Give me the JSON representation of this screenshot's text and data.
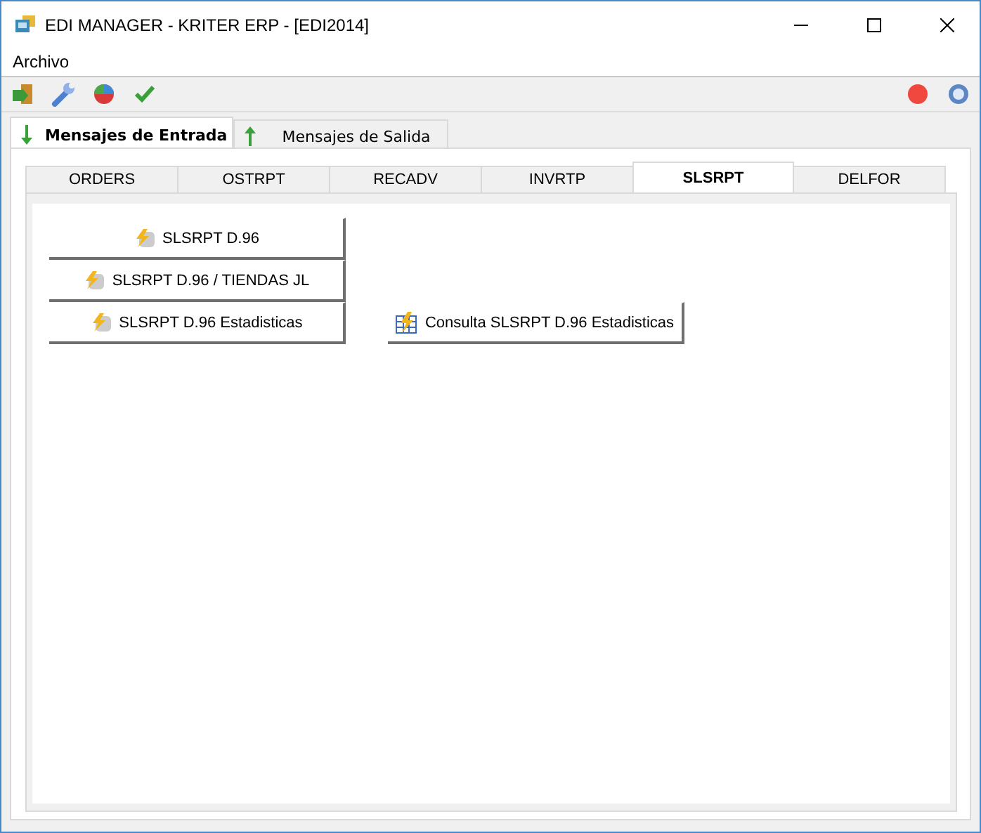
{
  "window": {
    "title": "EDI MANAGER - KRITER ERP - [EDI2014]"
  },
  "menu": [
    "Archivo"
  ],
  "toolbar": [
    {
      "kind": "exit"
    },
    {
      "kind": "wrench"
    },
    {
      "kind": "chart"
    },
    {
      "kind": "check"
    }
  ],
  "toolbar_right": [
    {
      "kind": "stop"
    },
    {
      "kind": "help"
    }
  ],
  "outer_tabs": [
    {
      "label": "Mensajes de Entrada",
      "kind": "down",
      "selected": true
    },
    {
      "label": "Mensajes de Salida",
      "kind": "up",
      "selected": false
    }
  ],
  "inner_tabs": [
    {
      "label": "ORDERS",
      "selected": false
    },
    {
      "label": "OSTRPT",
      "selected": false
    },
    {
      "label": "RECADV",
      "selected": false
    },
    {
      "label": "INVRTP",
      "selected": false
    },
    {
      "label": "SLSRPT",
      "selected": true
    },
    {
      "label": "DELFOR",
      "selected": false
    }
  ],
  "button_columns": [
    [
      {
        "label": "SLSRPT D.96",
        "kind": "run"
      },
      {
        "label": "SLSRPT D.96 / TIENDAS JL",
        "kind": "run"
      },
      {
        "label": "SLSRPT D.96 Estadisticas",
        "kind": "run"
      }
    ],
    [
      {
        "label": "Consulta SLSRPT D.96 Estadisticas",
        "kind": "query"
      }
    ]
  ]
}
